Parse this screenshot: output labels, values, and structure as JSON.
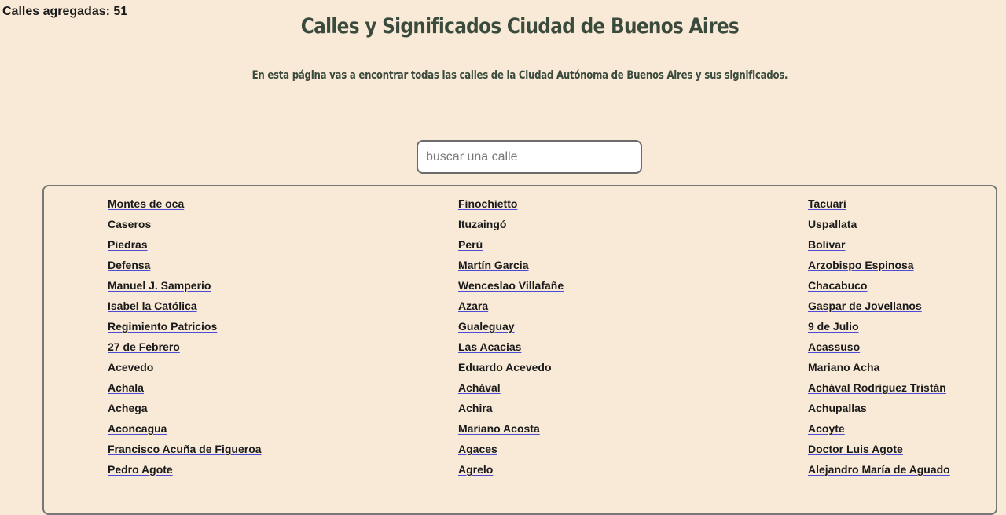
{
  "header": {
    "count_label": "Calles agregadas: 51",
    "title": "Calles y Significados Ciudad de Buenos Aires",
    "subtitle": "En esta página vas a encontrar todas las calles de la Ciudad Autónoma de Buenos Aires y sus significados."
  },
  "search": {
    "placeholder": "buscar una calle",
    "value": ""
  },
  "streets": {
    "col1": [
      "Montes de oca",
      "Caseros",
      "Piedras",
      "Defensa",
      "Manuel J. Samperio",
      "Isabel la Católica",
      "Regimiento Patricios",
      "27 de Febrero",
      "Acevedo",
      "Achala",
      "Achega",
      "Aconcagua",
      "Francisco Acuña de Figueroa",
      "Pedro Agote"
    ],
    "col2": [
      "Finochietto",
      "Ituzaingó",
      "Perú",
      "Martín Garcia",
      "Wenceslao Villafañe",
      "Azara",
      "Gualeguay",
      "Las Acacias",
      "Eduardo Acevedo",
      "Achával",
      "Achira",
      "Mariano Acosta",
      "Agaces",
      "Agrelo"
    ],
    "col3": [
      "Tacuari",
      "Uspallata",
      "Bolivar",
      "Arzobispo Espinosa",
      "Chacabuco",
      "Gaspar de Jovellanos",
      "9 de Julio",
      "Acassuso",
      "Mariano Acha",
      "Achával Rodriguez Tristán",
      "Achupallas",
      "Acoyte",
      "Doctor Luis Agote",
      "Alejandro María de Aguado"
    ]
  }
}
